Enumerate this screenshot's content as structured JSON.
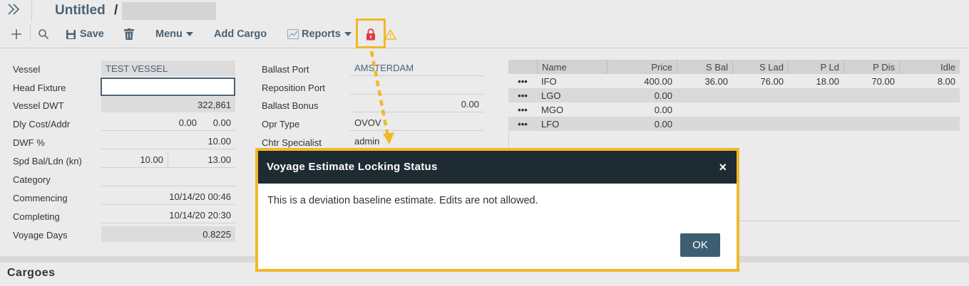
{
  "header": {
    "title": "Untitled",
    "separator": "/"
  },
  "toolbar": {
    "save_label": "Save",
    "menu_label": "Menu",
    "add_cargo_label": "Add Cargo",
    "reports_label": "Reports"
  },
  "form_left": {
    "vessel_label": "Vessel",
    "vessel_value": "TEST VESSEL",
    "head_fixture_label": "Head Fixture",
    "head_fixture_value": "",
    "vessel_dwt_label": "Vessel DWT",
    "vessel_dwt_value": "322,861",
    "dly_cost_label": "Dly Cost/Addr",
    "dly_cost_value": "0.00",
    "addr_value": "0.00",
    "dwf_label": "DWF %",
    "dwf_value": "10.00",
    "spd_label": "Spd Bal/Ldn (kn)",
    "spd_bal_value": "10.00",
    "spd_ldn_value": "13.00",
    "category_label": "Category",
    "category_value": "",
    "commencing_label": "Commencing",
    "commencing_value": "10/14/20 00:46",
    "completing_label": "Completing",
    "completing_value": "10/14/20 20:30",
    "voyage_days_label": "Voyage Days",
    "voyage_days_value": "0.8225"
  },
  "form_mid": {
    "ballast_port_label": "Ballast Port",
    "ballast_port_value": "AMSTERDAM",
    "reposition_port_label": "Reposition Port",
    "reposition_port_value": "",
    "ballast_bonus_label": "Ballast Bonus",
    "ballast_bonus_value": "0.00",
    "opr_type_label": "Opr Type",
    "opr_type_value": "OVOV",
    "chtr_specialist_label": "Chtr Specialist",
    "chtr_specialist_value": "admin"
  },
  "bunkers": {
    "columns": [
      "Name",
      "Price",
      "S Bal",
      "S Lad",
      "P Ld",
      "P Dis",
      "Idle"
    ],
    "row_menu": "•••",
    "rows": [
      {
        "name": "IFO",
        "price": "400.00",
        "s_bal": "36.00",
        "s_lad": "76.00",
        "p_ld": "18.00",
        "p_dis": "70.00",
        "idle": "8.00"
      },
      {
        "name": "LGO",
        "price": "0.00",
        "s_bal": "",
        "s_lad": "",
        "p_ld": "",
        "p_dis": "",
        "idle": ""
      },
      {
        "name": "MGO",
        "price": "0.00",
        "s_bal": "",
        "s_lad": "",
        "p_ld": "",
        "p_dis": "",
        "idle": ""
      },
      {
        "name": "LFO",
        "price": "0.00",
        "s_bal": "",
        "s_lad": "",
        "p_ld": "",
        "p_dis": "",
        "idle": ""
      }
    ]
  },
  "cargoes": {
    "title": "Cargoes"
  },
  "modal": {
    "title": "Voyage Estimate Locking Status",
    "close": "×",
    "message": "This is a deviation baseline estimate. Edits are not allowed.",
    "ok_label": "OK"
  },
  "colors": {
    "accent": "#4b6275",
    "highlight": "#f0b928",
    "lock": "#e0393e",
    "warning": "#f0b928",
    "modal_header": "#1f2b33"
  },
  "icons": [
    "expand-icon",
    "add-icon",
    "search-icon",
    "save-icon",
    "trash-icon",
    "chart-icon",
    "lock-icon",
    "warning-icon",
    "close-icon"
  ]
}
